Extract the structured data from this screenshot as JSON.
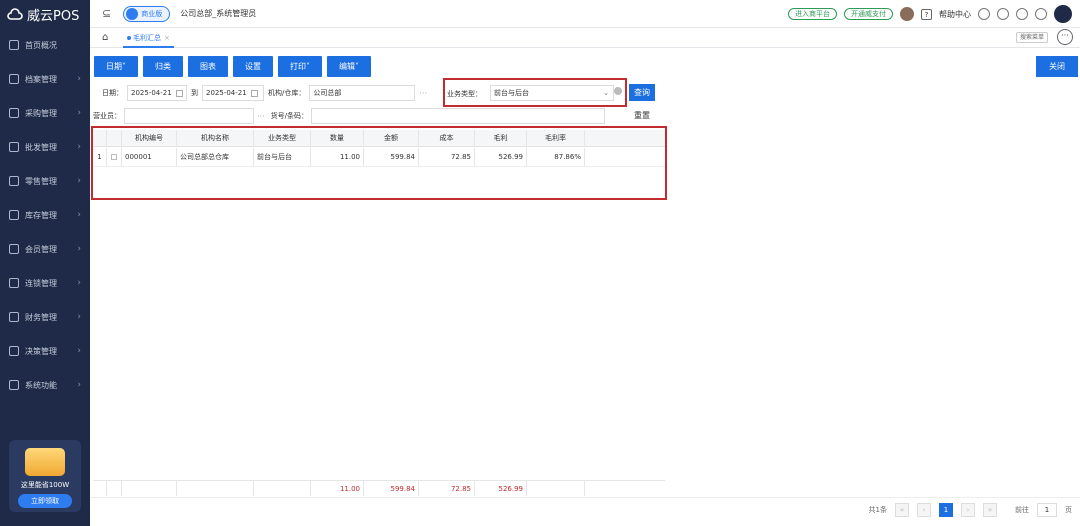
{
  "app": {
    "logo_text": "威云POS"
  },
  "sidebar": {
    "items": [
      {
        "label": "首页概况",
        "icon": "home-icon"
      },
      {
        "label": "档案管理",
        "icon": "folder-icon"
      },
      {
        "label": "采购管理",
        "icon": "cart-icon"
      },
      {
        "label": "批发管理",
        "icon": "warehouse-icon"
      },
      {
        "label": "零售管理",
        "icon": "store-icon"
      },
      {
        "label": "库存管理",
        "icon": "inventory-icon"
      },
      {
        "label": "会员管理",
        "icon": "member-icon"
      },
      {
        "label": "连锁管理",
        "icon": "chain-icon"
      },
      {
        "label": "财务管理",
        "icon": "finance-icon"
      },
      {
        "label": "决策管理",
        "icon": "decision-icon"
      },
      {
        "label": "系统功能",
        "icon": "gear-icon"
      }
    ],
    "promo_text": "这里能省100W",
    "promo_button": "立即领取"
  },
  "topbar": {
    "edition": "商业版",
    "org_user": "公司总部_系统管理员",
    "enter_platform": "进入商平台",
    "open_pay": "开通威支付",
    "help_center": "帮助中心"
  },
  "tabs": [
    {
      "label": "毛利汇总"
    }
  ],
  "menu_search": "搜索菜单",
  "toolbar": {
    "date": "日期",
    "classify": "归类",
    "chart": "图表",
    "settings": "设置",
    "print": "打印",
    "edit": "编辑",
    "close": "关闭"
  },
  "filters": {
    "date_label": "日期：",
    "date_from": "2025-04-21",
    "to_label": "到",
    "date_to": "2025-04-21",
    "org_label": "机构/仓库：",
    "org_value": "公司总部",
    "biz_type_label": "业务类型：",
    "biz_type_value": "前台与后台",
    "query": "查询",
    "salesperson_label": "营业员：",
    "goods_label": "货号/条码：",
    "reset": "重置"
  },
  "table": {
    "columns": [
      "机构编号",
      "机构名称",
      "业务类型",
      "数量",
      "金额",
      "成本",
      "毛利",
      "毛利率"
    ],
    "rows": [
      {
        "index": "1",
        "org_code": "000001",
        "org_name": "公司总部总仓库",
        "biz_type": "前台与后台",
        "qty": "11.00",
        "amount": "599.84",
        "cost": "72.85",
        "profit": "526.99",
        "margin": "87.86%"
      }
    ],
    "totals": {
      "qty": "11.00",
      "amount": "599.84",
      "cost": "72.85",
      "profit": "526.99"
    }
  },
  "pager": {
    "total": "共1条",
    "current_page": "1",
    "goto_label": "前往",
    "goto_value": "1",
    "page_unit": "页"
  },
  "colors": {
    "sidebar_bg": "#1e2a47",
    "primary": "#1c6fe0",
    "highlight_red": "#c42b30"
  }
}
